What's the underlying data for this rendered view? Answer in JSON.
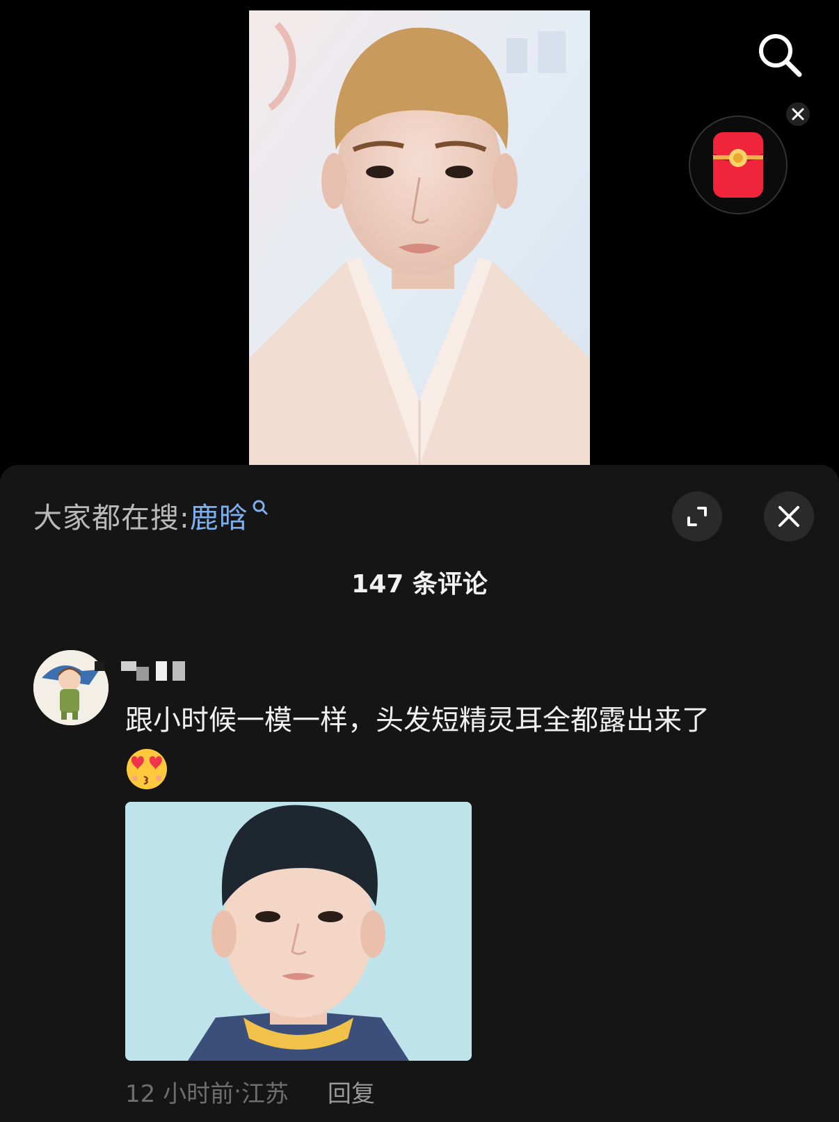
{
  "hot_search": {
    "prefix": "大家都在搜:",
    "keyword": "鹿晗"
  },
  "comments_header": {
    "count_label": "147 条评论"
  },
  "comment": {
    "username": "",
    "text": "跟小时候一模一样，头发短精灵耳全都露出来了",
    "emoji": "heart-eyes-kiss-emoji",
    "time": "12 小时前",
    "separator": " · ",
    "location": "江苏",
    "reply_label": "回复"
  },
  "colors": {
    "sheet_bg": "#151515",
    "keyword_link": "#7fb0ee",
    "red_packet": "#f0243a"
  },
  "icons": {
    "search": "search-icon",
    "close_small": "close-icon",
    "red_packet": "red-packet-icon",
    "expand": "expand-icon",
    "close": "close-icon"
  }
}
